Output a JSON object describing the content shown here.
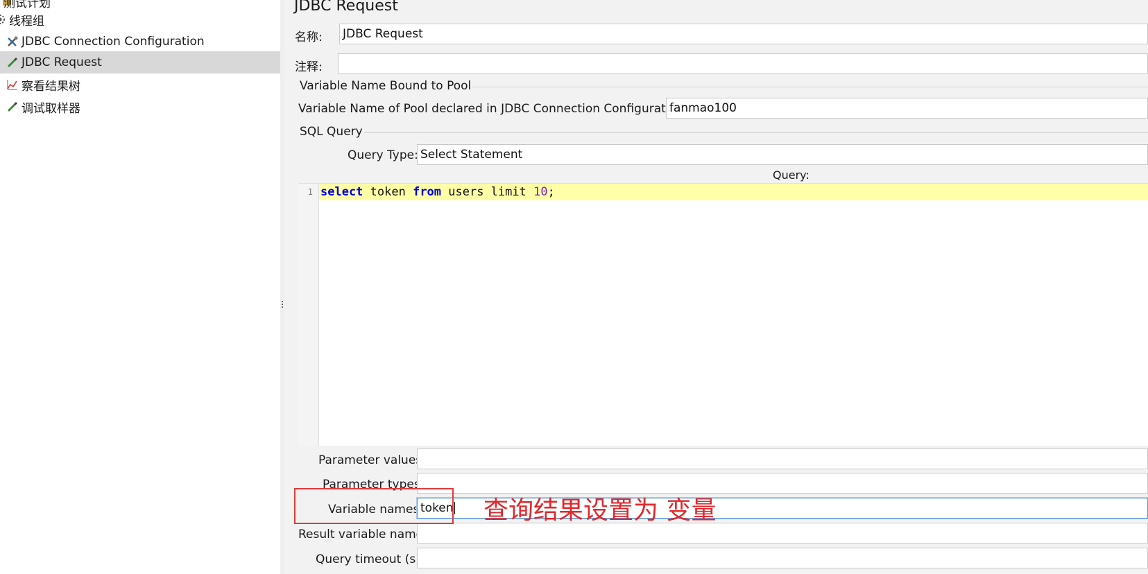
{
  "tree": {
    "items": [
      {
        "label": "测试计划",
        "icon": "test-plan-icon"
      },
      {
        "label": "线程组",
        "icon": "gear-icon"
      },
      {
        "label": "JDBC Connection Configuration",
        "icon": "wrench-icon"
      },
      {
        "label": "JDBC Request",
        "icon": "pipette-icon",
        "selected": true
      },
      {
        "label": "察看结果树",
        "icon": "chart-icon"
      },
      {
        "label": "调试取样器",
        "icon": "pipette-icon"
      }
    ]
  },
  "panel": {
    "title": "JDBC Request",
    "name_label": "名称:",
    "name_value": "JDBC Request",
    "comment_label": "注释:",
    "comment_value": "",
    "pool_section_title": "Variable Name Bound to Pool",
    "pool_label": "Variable Name of Pool declared in JDBC Connection Configuration:",
    "pool_value": "fanmao100",
    "sql_section_title": "SQL Query",
    "query_type_label": "Query Type:",
    "query_type_value": "Select Statement",
    "query_label": "Query:",
    "editor": {
      "line_number": "1",
      "tokens": {
        "kw_select": "select",
        "t_token": " token ",
        "kw_from": "from",
        "t_rest": " users limit ",
        "num": "10",
        "semi": ";"
      }
    },
    "param_values_label": "Parameter values:",
    "param_values_value": "",
    "param_types_label": "Parameter types:",
    "param_types_value": "",
    "variable_names_label": "Variable names:",
    "variable_names_value": "token",
    "result_var_label": "Result variable name:",
    "result_var_value": "",
    "timeout_label": "Query timeout (s):",
    "timeout_value": ""
  },
  "annotation": {
    "text": "查询结果设置为 变量",
    "color": "#e2282c"
  }
}
